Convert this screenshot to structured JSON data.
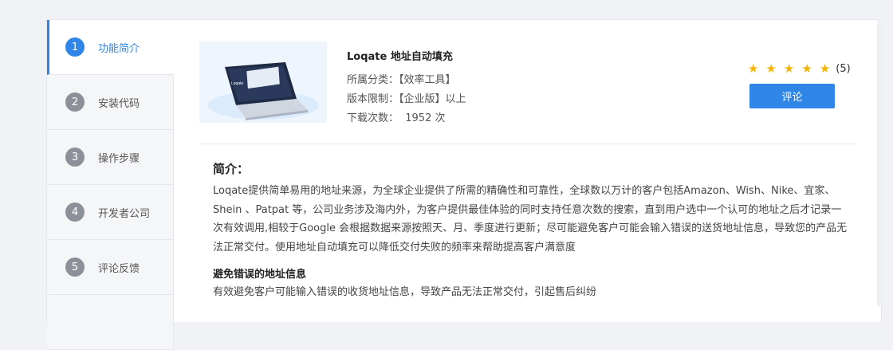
{
  "sidebar": {
    "items": [
      {
        "num": "1",
        "label": "功能简介"
      },
      {
        "num": "2",
        "label": "安装代码"
      },
      {
        "num": "3",
        "label": "操作步骤"
      },
      {
        "num": "4",
        "label": "开发者公司"
      },
      {
        "num": "5",
        "label": "评论反馈"
      }
    ],
    "active_index": 0
  },
  "app": {
    "title": "Loqate 地址自动填充",
    "category": "所属分类：【效率工具】",
    "version_limit": "版本限制：【企业版】以上",
    "downloads": "下载次数：  1952 次",
    "rating_stars": 5,
    "rating_count": "(5)",
    "review_button": "评论"
  },
  "intro": {
    "heading": "简介：",
    "body": "Loqate提供简单易用的地址来源，为全球企业提供了所需的精确性和可靠性，全球数以万计的客户包括Amazon、Wish、Nike、宜家、Shein 、Patpat 等，公司业务涉及海内外，为客户提供最佳体验的同时支持任意次数的搜索，直到用户选中一个认可的地址之后才记录一次有效调用,相较于Google 会根据数据来源按照天、月、季度进行更新；尽可能避免客户可能会输入错误的送货地址信息，导致您的产品无法正常交付。使用地址自动填充可以降低交付失败的频率来帮助提高客户满意度",
    "sub_heading": "避免错误的地址信息",
    "sub_text": "有效避免客户可能输入错误的收货地址信息，导致产品无法正常交付，引起售后纠纷"
  },
  "colors": {
    "accent": "#2f86e6",
    "star": "#f5b301"
  }
}
